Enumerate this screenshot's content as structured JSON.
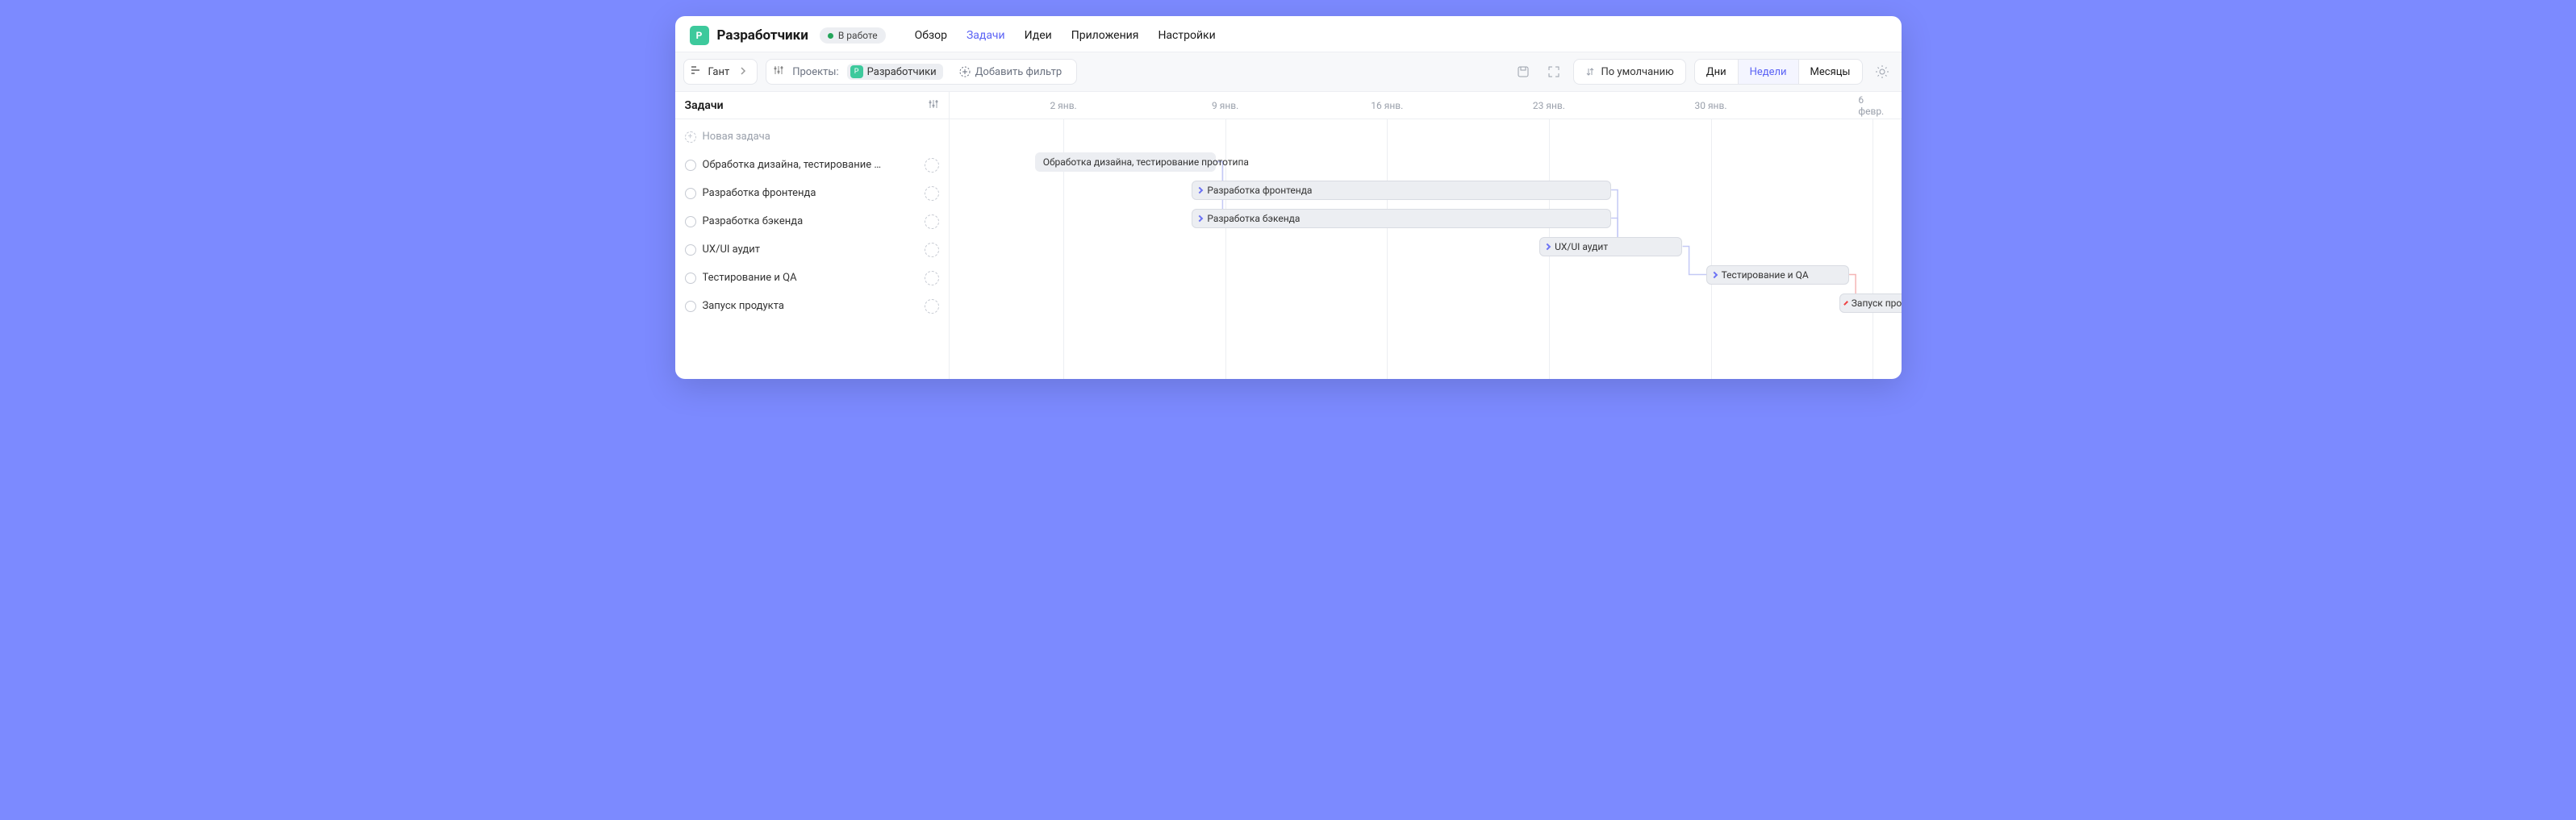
{
  "header": {
    "project_badge_letter": "Р",
    "project_title": "Разработчики",
    "status_label": "В работе",
    "nav": [
      {
        "label": "Обзор",
        "active": false
      },
      {
        "label": "Задачи",
        "active": true
      },
      {
        "label": "Идеи",
        "active": false
      },
      {
        "label": "Приложения",
        "active": false
      },
      {
        "label": "Настройки",
        "active": false
      }
    ]
  },
  "toolbar": {
    "view_label": "Гант",
    "filter_prefix": "Проекты:",
    "filter_project_letter": "Р",
    "filter_project_name": "Разработчики",
    "add_filter_label": "Добавить фильтр",
    "sort_label": "По умолчанию",
    "scale": {
      "days": "Дни",
      "weeks": "Недели",
      "months": "Месяцы",
      "active": "weeks"
    }
  },
  "sidebar": {
    "header": "Задачи",
    "new_task_label": "Новая задача",
    "tasks": [
      {
        "label": "Обработка дизайна, тестирование …"
      },
      {
        "label": "Разработка фронтенда"
      },
      {
        "label": "Разработка бэкенда"
      },
      {
        "label": "UX/UI аудит"
      },
      {
        "label": "Тестирование и QA"
      },
      {
        "label": "Запуск продукта"
      }
    ]
  },
  "gantt": {
    "ticks": [
      {
        "label": "2 янв.",
        "pct": 12
      },
      {
        "label": "9 янв.",
        "pct": 29
      },
      {
        "label": "16 янв.",
        "pct": 46
      },
      {
        "label": "23 янв.",
        "pct": 63
      },
      {
        "label": "30 янв.",
        "pct": 80
      },
      {
        "label": "6 февр.",
        "pct": 97
      }
    ],
    "bars": [
      {
        "label": "Обработка дизайна, тестирование прототипа",
        "row": 1,
        "start_pct": 9,
        "width_pct": 19,
        "first": true,
        "red": false
      },
      {
        "label": "Разработка фронтенда",
        "row": 2,
        "start_pct": 25.5,
        "width_pct": 44,
        "first": false,
        "red": false
      },
      {
        "label": "Разработка бэкенда",
        "row": 3,
        "start_pct": 25.5,
        "width_pct": 44,
        "first": false,
        "red": false
      },
      {
        "label": "UX/UI аудит",
        "row": 4,
        "start_pct": 62,
        "width_pct": 15,
        "first": false,
        "red": false
      },
      {
        "label": "Тестирование и QA",
        "row": 5,
        "start_pct": 79.5,
        "width_pct": 15,
        "first": false,
        "red": false
      },
      {
        "label": "Запуск продукта",
        "row": 6,
        "start_pct": 93.5,
        "width_pct": 10,
        "first": false,
        "red": true
      }
    ],
    "deps": [
      {
        "from_row": 1,
        "from_pct": 28,
        "to_row": 2,
        "to_pct": 25.5,
        "red": false
      },
      {
        "from_row": 1,
        "from_pct": 28,
        "to_row": 3,
        "to_pct": 25.5,
        "red": false
      },
      {
        "from_row": 2,
        "from_pct": 69.5,
        "to_row": 4,
        "to_pct": 62,
        "red": false
      },
      {
        "from_row": 3,
        "from_pct": 69.5,
        "to_row": 4,
        "to_pct": 62,
        "red": false
      },
      {
        "from_row": 4,
        "from_pct": 77,
        "to_row": 5,
        "to_pct": 79.5,
        "red": false
      },
      {
        "from_row": 5,
        "from_pct": 94.5,
        "to_row": 6,
        "to_pct": 93.5,
        "red": true
      }
    ]
  }
}
